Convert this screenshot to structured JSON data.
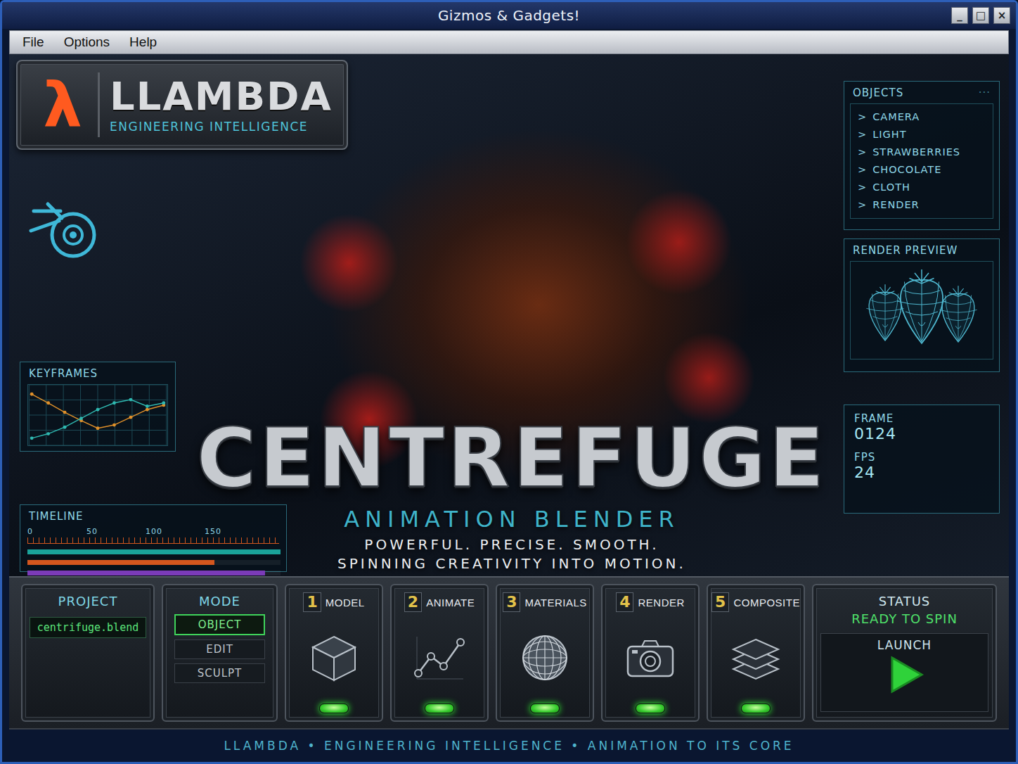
{
  "window": {
    "title": "Gizmos & Gadgets!",
    "controls": [
      {
        "label": "_"
      },
      {
        "label": "□"
      },
      {
        "label": "×"
      }
    ]
  },
  "menu": [
    "File",
    "Options",
    "Help"
  ],
  "logo": {
    "symbol": "λ",
    "name": "LLAMBDA",
    "tagline": "ENGINEERING INTELLIGENCE"
  },
  "objects": {
    "title": "OBJECTS",
    "more": "···",
    "bullet": ">",
    "items": [
      "CAMERA",
      "LIGHT",
      "STRAWBERRIES",
      "CHOCOLATE",
      "CLOTH",
      "RENDER"
    ]
  },
  "render_preview": {
    "title": "RENDER PREVIEW"
  },
  "frame": {
    "label": "FRAME",
    "value": "0124"
  },
  "fps": {
    "label": "FPS",
    "value": "24"
  },
  "keyframes": {
    "title": "KEYFRAMES",
    "series": [
      {
        "color": "#e0902a",
        "values": [
          88,
          72,
          55,
          40,
          26,
          32,
          46,
          60,
          68
        ]
      },
      {
        "color": "#2fb8b0",
        "values": [
          8,
          16,
          28,
          44,
          60,
          72,
          78,
          66,
          72
        ]
      }
    ]
  },
  "timeline": {
    "title": "TIMELINE",
    "ticks": [
      "0",
      "50",
      "100",
      "150"
    ],
    "tracks": [
      {
        "level": 1.0,
        "color": "#1aa39a"
      },
      {
        "level": 0.74,
        "color": "#d4561e"
      },
      {
        "level": 0.94,
        "color": "#7b3bb8"
      }
    ]
  },
  "hero": {
    "title": "CENTREFUGE",
    "subtitle": "ANIMATION BLENDER",
    "taglines": [
      "POWERFUL. PRECISE. SMOOTH.",
      "SPINNING CREATIVITY INTO MOTION."
    ]
  },
  "project": {
    "title": "PROJECT",
    "file": "centrifuge.blend"
  },
  "mode": {
    "title": "MODE",
    "options": [
      {
        "label": "OBJECT",
        "selected": true
      },
      {
        "label": "EDIT",
        "selected": false
      },
      {
        "label": "SCULPT",
        "selected": false
      }
    ]
  },
  "tools": [
    {
      "number": "1",
      "label": "MODEL",
      "on": true
    },
    {
      "number": "2",
      "label": "ANIMATE",
      "on": true
    },
    {
      "number": "3",
      "label": "MATERIALS",
      "on": true
    },
    {
      "number": "4",
      "label": "RENDER",
      "on": true
    },
    {
      "number": "5",
      "label": "COMPOSITE",
      "on": true
    }
  ],
  "status": {
    "title": "STATUS",
    "value": "READY TO SPIN",
    "launch": "LAUNCH"
  },
  "footer": "LLAMBDA • ENGINEERING INTELLIGENCE • ANIMATION TO ITS CORE"
}
